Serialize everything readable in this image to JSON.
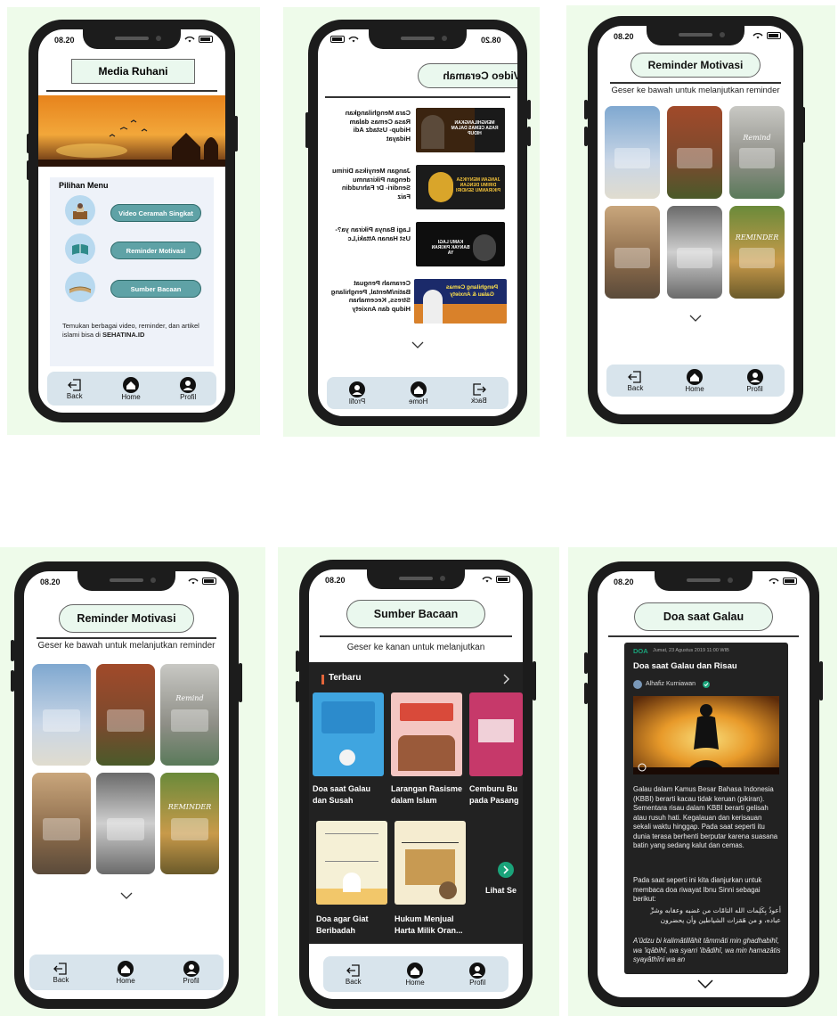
{
  "colors": {
    "panel_bg": "#eefbea",
    "phone_frame": "#1c1c1c",
    "title_pill_bg": "#eaf8ee",
    "menu_button": "#5fa2a6",
    "navbar_bg": "#d8e4ec",
    "dark_card": "#222222",
    "accent_teal": "#1aa37a",
    "accent_orange": "#e3653a"
  },
  "screens": {
    "media_ruhani": {
      "time": "08.20",
      "title": "Media Ruhani",
      "menu_heading": "Pilihan Menu",
      "menu_items": [
        {
          "label": "Video Ceramah Singkat",
          "icon": "mosque-icon"
        },
        {
          "label": "Reminder Motivasi",
          "icon": "quran-icon"
        },
        {
          "label": "Sumber Bacaan",
          "icon": "book-icon"
        }
      ],
      "footer_text": "Temukan berbagai video, reminder, dan artikel islami bisa di ",
      "footer_brand": "SEHATINA.ID",
      "nav": [
        "Back",
        "Home",
        "Profil"
      ]
    },
    "video_ceramah": {
      "time": "08.20",
      "title": "Video Ceramah",
      "videos": [
        {
          "title": "Cara Menghilangkan Rasa Cemas dalam Hidup- Ustadz Adi Hidayat",
          "thumb_text": "MENGHILANGKAN RASA CEMAS DALAM HIDUP"
        },
        {
          "title": "Jangan Menyiksa Dirimu dengan Pikiranmu Sendiri- Dr Fahruddin Faiz",
          "thumb_text": "JANGAN MENYIKSA DIRIMU DENGAN PIKIRANMU SENDIRI"
        },
        {
          "title": "Lagi Banya Pikiran ya?- Ust Hanan Attaki,Lc",
          "thumb_text": "KAMU LAGI BANYAK PIKIRAN YA"
        },
        {
          "title": "Ceramah Penguat Batin/Mental, Penghilang Stress, Kecemahan Hidup dan Anxiety",
          "thumb_text": "Penghilang Cemas Galau & Anxiety"
        }
      ],
      "nav": [
        "Back",
        "Home",
        "Profil"
      ]
    },
    "reminder_1": {
      "time": "08.20",
      "title": "Reminder Motivasi",
      "hint": "Geser ke bawah untuk melanjutkan reminder",
      "thumb_labels": [
        "",
        "",
        "Remind",
        "",
        "",
        "REMINDER"
      ],
      "nav": [
        "Back",
        "Home",
        "Profil"
      ]
    },
    "reminder_2": {
      "time": "08.20",
      "title": "Reminder Motivasi",
      "hint": "Geser ke bawah untuk melanjutkan reminder",
      "thumb_labels": [
        "",
        "",
        "Remind",
        "",
        "",
        "REMINDER"
      ],
      "nav": [
        "Back",
        "Home",
        "Profil"
      ]
    },
    "sumber_bacaan": {
      "time": "08.20",
      "title": "Sumber Bacaan",
      "hint": "Geser ke kanan untuk melanjutkan",
      "section": "Terbaru",
      "cards_row1": [
        {
          "line1": "Doa saat Galau",
          "line2": "dan Susah"
        },
        {
          "line1": "Larangan Rasisme",
          "line2": "dalam Islam"
        },
        {
          "line1": "Cemburu Bu",
          "line2": "pada Pasang"
        }
      ],
      "cards_row2": [
        {
          "line1": "Doa agar Giat",
          "line2": "Beribadah"
        },
        {
          "line1": "Hukum Menjual",
          "line2": "Harta Milik Oran..."
        }
      ],
      "see_more": "Lihat Se",
      "nav": [
        "Back",
        "Home",
        "Profil"
      ]
    },
    "doa_galau": {
      "time": "08.20",
      "title": "Doa saat Galau",
      "category": "DOA",
      "date": "Jumat, 23 Agustus 2019 11:00 WIB",
      "headline": "Doa saat Galau dan Risau",
      "author": "Alhafiz Kurniawan",
      "para1": "Galau dalam Kamus Besar Bahasa Indonesia (KBBI) berarti kacau tidak keruan (pikiran). Sementara risau dalam KBBI berarti gelisah atau rusuh hati. Kegalauan dan kerisauan sekali waktu hinggap. Pada saat seperti itu dunia terasa berhenti berputar karena suasana batin yang sedang kalut dan cemas.",
      "para2": "Pada saat seperti ini kita dianjurkan untuk membaca doa riwayat Ibnu Sinni sebagai berikut:",
      "arabic": "أعوذُ بِكَلِمات الله التامّات من غضبه وعقابه وشرِّ عباده، و من هَمَزات الشياطين وأن يحضرون",
      "latin": "A'ûdzu bi kalimâtillâhit tâmmâti min ghadhabihî, wa 'iqâbihî, wa syarri 'ibâdihî, wa min hamazâtis syayâthîni wa an"
    }
  }
}
